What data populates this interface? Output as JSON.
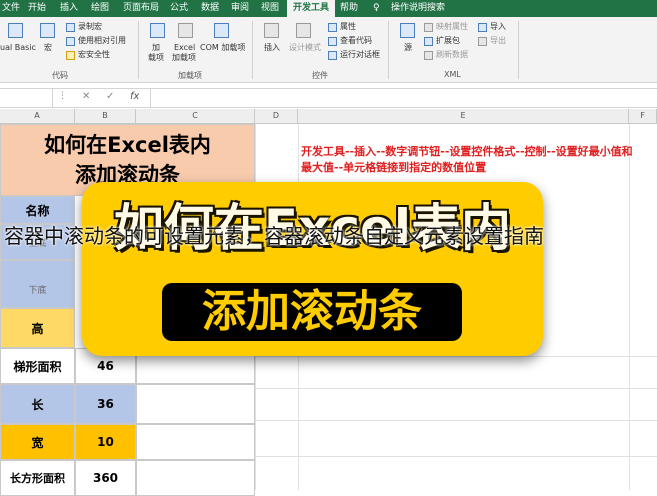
{
  "menubar": {
    "items": [
      "文件",
      "开始",
      "插入",
      "绘图",
      "页面布局",
      "公式",
      "数据",
      "审阅",
      "视图",
      "开发工具",
      "帮助",
      "操作说明搜索"
    ],
    "active": "开发工具"
  },
  "ribbon": {
    "code_group": {
      "vb_label": "ual Basic",
      "macro_label": "宏",
      "record_macro": "录制宏",
      "relative_ref": "使用相对引用",
      "macro_security": "宏安全性",
      "group_label": "代码"
    },
    "addins_group": {
      "addin_label1": "加",
      "addin_label2": "载项",
      "excel_addin1": "Excel",
      "excel_addin2": "加载项",
      "com_addin": "COM 加载项",
      "group_label": "加载项"
    },
    "controls_group": {
      "insert_label": "插入",
      "design_mode": "设计模式",
      "properties": "属性",
      "view_code": "查看代码",
      "run_dialog": "运行对话框",
      "group_label": "控件"
    },
    "xml_group": {
      "source": "源",
      "map_props": "映射属性",
      "expansion_pack": "扩展包",
      "refresh_data": "刷新数据",
      "import": "导入",
      "export": "导出",
      "group_label": "XML"
    }
  },
  "formula_bar": {
    "cancel": "✕",
    "enter": "✓",
    "fx": "fx",
    "content": ""
  },
  "columns": [
    "A",
    "B",
    "C",
    "D",
    "E",
    "F"
  ],
  "sheet": {
    "title_line1": "如何在Excel表内",
    "title_line2": "添加滚动条",
    "name_header": "名称",
    "rows": [
      {
        "label": "上底",
        "value": ""
      },
      {
        "label": "下底",
        "value": ""
      },
      {
        "label": "高",
        "value": ""
      },
      {
        "label": "梯形面积",
        "value": "46"
      },
      {
        "label": "长",
        "value": "36"
      },
      {
        "label": "宽",
        "value": "10"
      },
      {
        "label": "长方形面积",
        "value": "360"
      }
    ],
    "instruction": "开发工具--插入--数字调节钮--设置控件格式--控制--设置好最小值和最大值--单元格链接到指定的数值位置"
  },
  "banner": {
    "line1": "如何在Excel表内",
    "line2": "添加滚动条"
  },
  "caption": "容器中滚动条的可设置元素，容器滚动条自定义元素设置指南",
  "colors": {
    "excel_green": "#217346",
    "title_fill": "#f8cbad",
    "label_fill": "#b4c6e7",
    "height_fill": "#ffd966",
    "width_fill": "#ffc000",
    "banner_yellow": "#ffcc00",
    "instruction_red": "#e02020"
  }
}
